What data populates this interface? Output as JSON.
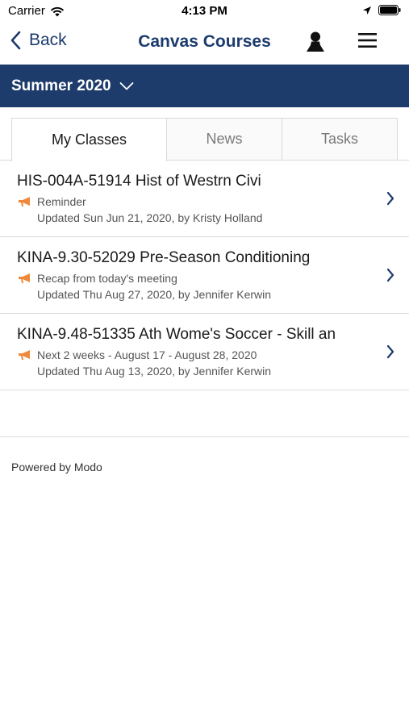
{
  "status_bar": {
    "carrier": "Carrier",
    "time": "4:13 PM"
  },
  "nav": {
    "back_label": "Back",
    "title": "Canvas Courses"
  },
  "term": {
    "label": "Summer 2020"
  },
  "tabs": [
    {
      "label": "My Classes",
      "active": true
    },
    {
      "label": "News",
      "active": false
    },
    {
      "label": "Tasks",
      "active": false
    }
  ],
  "classes": [
    {
      "title": "HIS-004A-51914 Hist of Westrn Civi",
      "announcement": "Reminder",
      "updated": "Updated Sun Jun 21, 2020, by Kristy Holland"
    },
    {
      "title": "KINA-9.30-52029 Pre-Season Conditioning",
      "announcement": "Recap from today's meeting",
      "updated": "Updated Thu Aug 27, 2020, by Jennifer Kerwin"
    },
    {
      "title": "KINA-9.48-51335 Ath Wome's Soccer - Skill an",
      "announcement": "Next 2 weeks - August 17 - August 28, 2020",
      "updated": "Updated Thu Aug 13, 2020, by Jennifer Kerwin"
    }
  ],
  "footer": {
    "text": "Powered by Modo"
  },
  "colors": {
    "brand_navy": "#1d3b6b",
    "link_blue": "#1c3b6e",
    "announcement_orange": "#f0883a"
  },
  "icons": [
    "wifi-icon",
    "location-arrow-icon",
    "battery-icon",
    "back-chevron-icon",
    "person-icon",
    "hamburger-menu-icon",
    "chevron-down-icon",
    "megaphone-icon",
    "chevron-right-icon"
  ]
}
